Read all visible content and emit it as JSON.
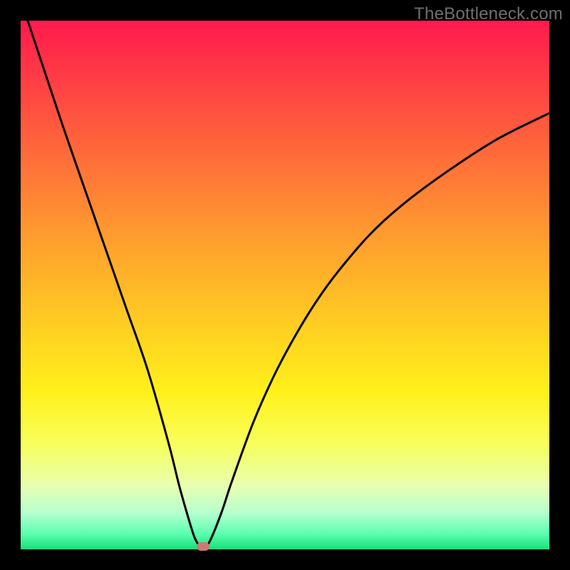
{
  "watermark": "TheBottleneck.com",
  "colors": {
    "curve_stroke": "#000000",
    "marker_fill": "#cc7a78",
    "frame_bg": "#000000"
  },
  "chart_data": {
    "type": "line",
    "title": "",
    "xlabel": "",
    "ylabel": "",
    "xlim": [
      0,
      100
    ],
    "ylim": [
      0,
      100
    ],
    "grid": false,
    "series": [
      {
        "name": "bottleneck-curve",
        "x": [
          0,
          4,
          8,
          12,
          16,
          20,
          24,
          28,
          30,
          32,
          33,
          34,
          35,
          36,
          38,
          40,
          44,
          48,
          52,
          56,
          60,
          66,
          72,
          80,
          90,
          100
        ],
        "values": [
          104,
          92,
          80,
          68.5,
          57,
          45.5,
          34,
          20,
          12,
          5,
          2,
          0.5,
          0.5,
          2,
          7,
          13,
          24,
          33,
          40.5,
          47,
          52.5,
          59.5,
          65,
          71,
          77.5,
          82.5
        ]
      }
    ],
    "marker": {
      "x": 34.5,
      "y": 0.5
    }
  }
}
